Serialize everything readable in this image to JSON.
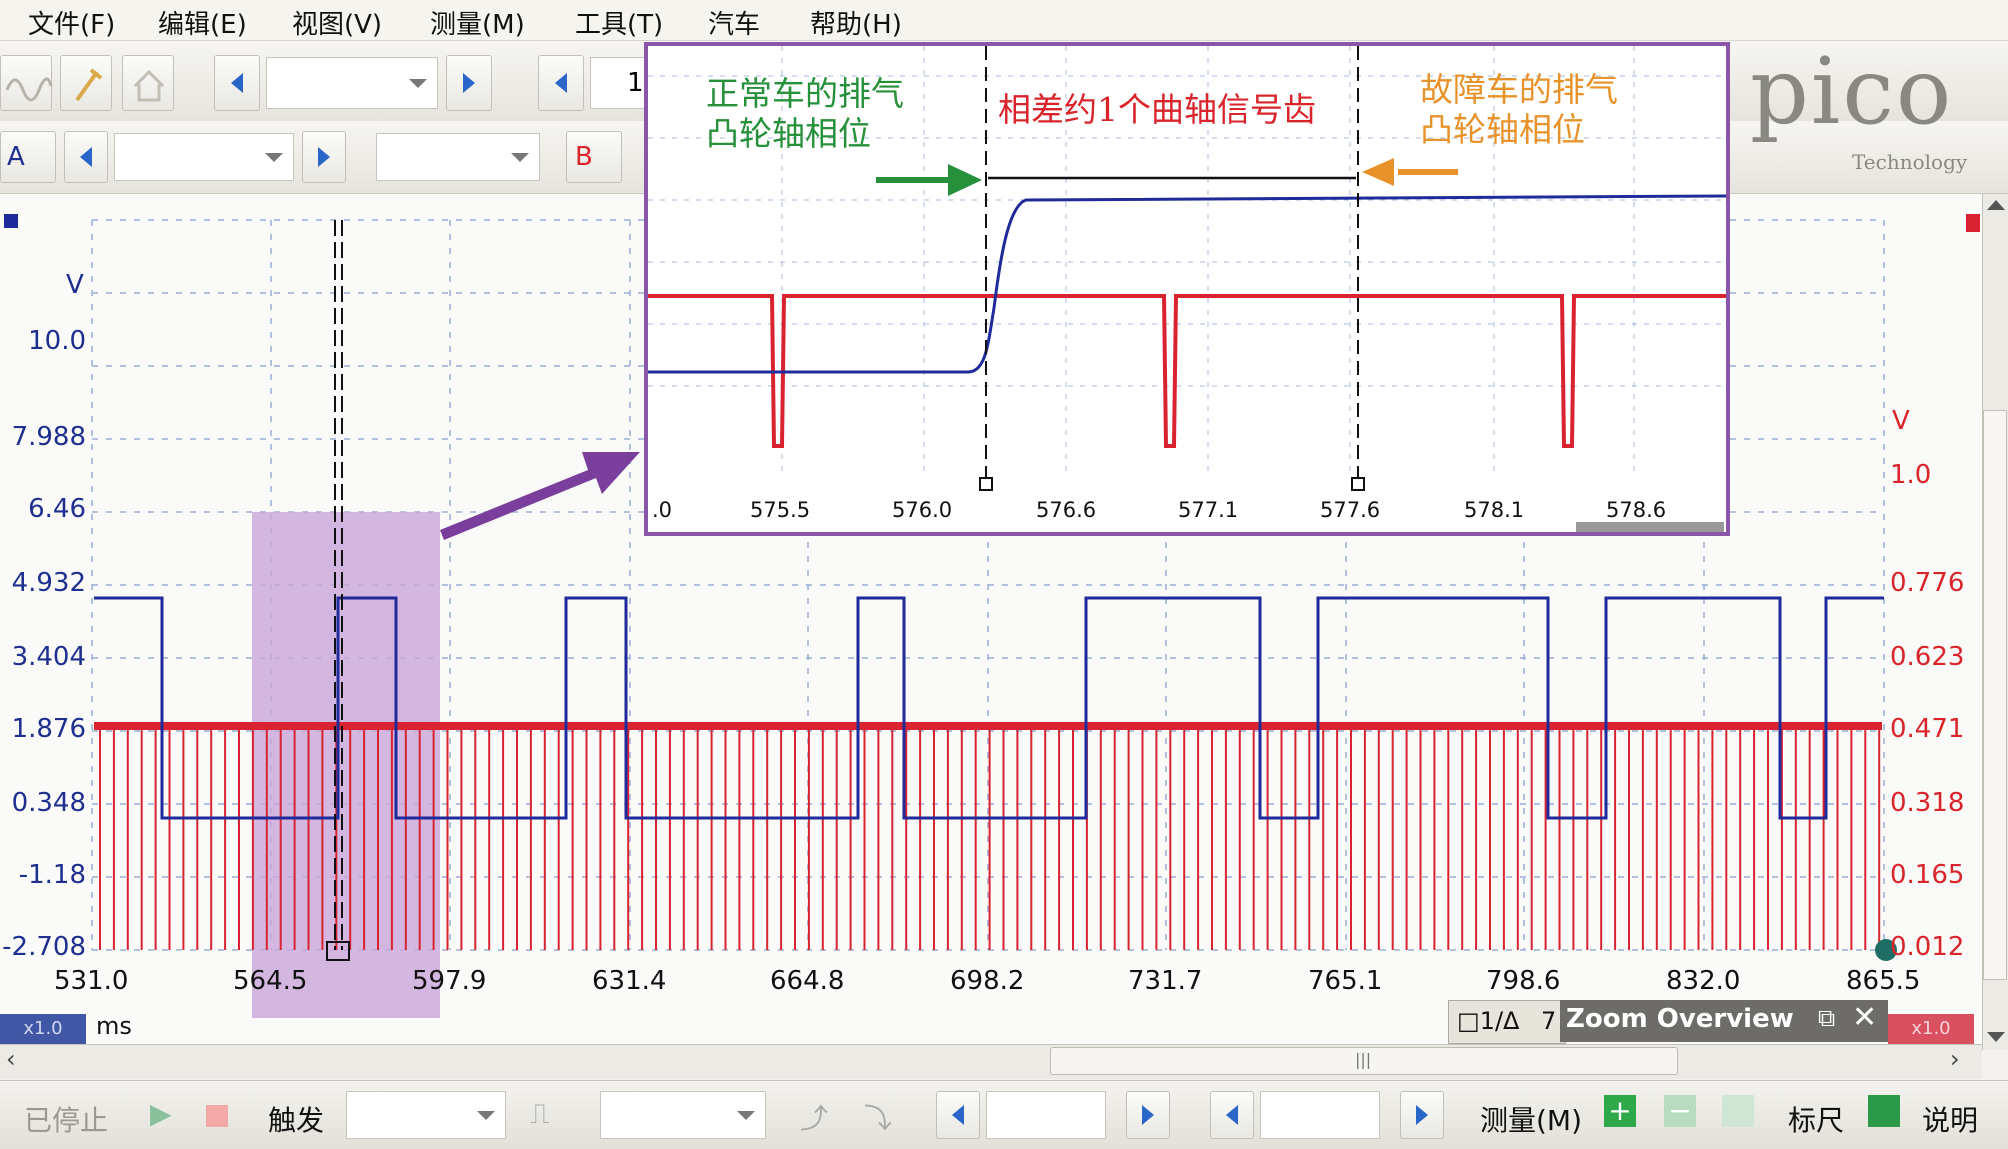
{
  "menu": {
    "items": [
      "文件(F)",
      "编辑(E)",
      "视图(V)",
      "测量(M)",
      "工具(T)",
      "汽车",
      "帮助(H)"
    ]
  },
  "toolbar2": {
    "channel_a": "A",
    "channel_b": "B"
  },
  "main_toolbar_partial": "1",
  "logo": {
    "text": "pico",
    "sub": "Technology"
  },
  "left_axis": {
    "unit": "V",
    "ticks": [
      "10.0",
      "7.988",
      "6.46",
      "4.932",
      "3.404",
      "1.876",
      "0.348",
      "-1.18",
      "-2.708"
    ]
  },
  "right_axis": {
    "unit": "V",
    "ticks": [
      "1.0",
      "0.776",
      "0.623",
      "0.471",
      "0.318",
      "0.165",
      "0.012"
    ]
  },
  "x_axis": {
    "unit": "ms",
    "ticks": [
      "531.0",
      "564.5",
      "597.9",
      "631.4",
      "664.8",
      "698.2",
      "731.7",
      "765.1",
      "798.6",
      "832.0",
      "865.5"
    ]
  },
  "zoom_left": "x1.0",
  "zoom_right": "x1.0",
  "ruler_tag": "1/Δ",
  "ruler_value": "7",
  "zoom_overview": "Zoom Overview",
  "inset": {
    "left_note": [
      "正常车的排气",
      "凸轮轴相位"
    ],
    "middle_note": "相差约1个曲轴信号齿",
    "right_note": [
      "故障车的排气",
      "凸轮轴相位"
    ],
    "xticks": [
      ".0",
      "575.5",
      "576.0",
      "576.6",
      "577.1",
      "577.6",
      "578.1",
      "578.6"
    ],
    "colors": {
      "green": "#27903a",
      "red": "#d9242c",
      "orange": "#e8932a",
      "frame": "#8a57a8"
    }
  },
  "statusbar": {
    "stopped": "已停止",
    "trigger": "触发",
    "measure": "测量(M)",
    "ruler": "标尺",
    "notes": "说明"
  },
  "colors": {
    "blue_trace": "#1f2b9a",
    "red_trace": "#d92331",
    "left_axis_text": "#1f2f8f",
    "right_axis_text": "#d9242c",
    "highlight": "#c9a6d9",
    "pointer": "#7a3f9d"
  }
}
